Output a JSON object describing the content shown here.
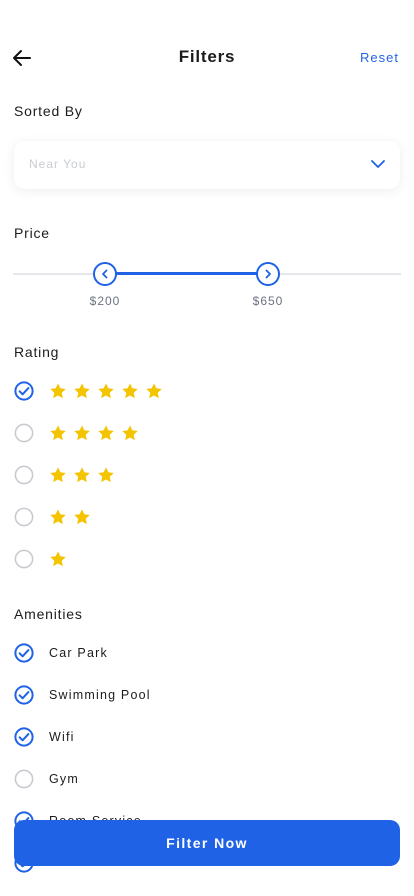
{
  "header": {
    "title": "Filters",
    "reset_label": "Reset"
  },
  "sorted_by": {
    "title": "Sorted By",
    "value": "Near You"
  },
  "price": {
    "title": "Price",
    "min_label": "$200",
    "max_label": "$650",
    "min_value": 200,
    "max_value": 650
  },
  "rating": {
    "title": "Rating",
    "options": [
      {
        "stars": 5,
        "checked": true
      },
      {
        "stars": 4,
        "checked": false
      },
      {
        "stars": 3,
        "checked": false
      },
      {
        "stars": 2,
        "checked": false
      },
      {
        "stars": 1,
        "checked": false
      }
    ]
  },
  "amenities": {
    "title": "Amenities",
    "items": [
      {
        "label": "Car Park",
        "checked": true
      },
      {
        "label": "Swimming Pool",
        "checked": true
      },
      {
        "label": "Wifi",
        "checked": true
      },
      {
        "label": "Gym",
        "checked": false
      },
      {
        "label": "Room Service",
        "checked": true
      },
      {
        "label": "",
        "checked": true
      }
    ]
  },
  "filter_button": {
    "label": "Filter Now"
  },
  "colors": {
    "accent": "#1f62e6",
    "star": "#f5c400",
    "unchecked": "#c7c9ce"
  }
}
